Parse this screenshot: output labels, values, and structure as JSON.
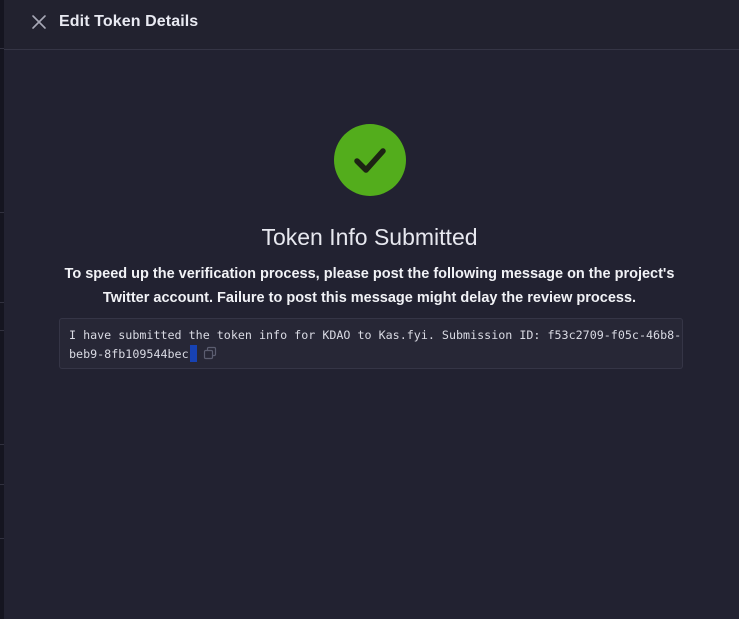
{
  "header": {
    "title": "Edit Token Details",
    "close_icon": "close-icon"
  },
  "status": {
    "icon": "check-icon",
    "accent_color": "#53ad1c",
    "title": "Token Info Submitted"
  },
  "instructions": {
    "line1": "To speed up the verification process, please post the following message on the project's",
    "line2": "Twitter account. Failure to post this message might delay the review process."
  },
  "message": {
    "line1": "I have submitted the token info for KDAO to Kas.fyi. Submission ID: f53c2709-f05c-46b8-",
    "line2": "beb9-8fb109544bec",
    "copy_icon": "copy-icon"
  }
}
